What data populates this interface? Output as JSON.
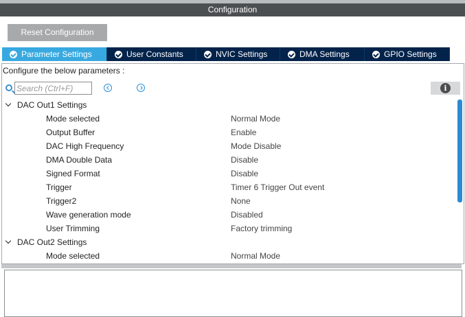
{
  "window": {
    "title": "Configuration"
  },
  "toolbar": {
    "reset_label": "Reset Configuration"
  },
  "tabs": [
    {
      "label": "Parameter Settings",
      "active": true,
      "icon": "check-circle-icon"
    },
    {
      "label": "User Constants",
      "active": false,
      "icon": "check-circle-icon"
    },
    {
      "label": "NVIC Settings",
      "active": false,
      "icon": "check-circle-icon"
    },
    {
      "label": "DMA Settings",
      "active": false,
      "icon": "check-circle-icon"
    },
    {
      "label": "GPIO Settings",
      "active": false,
      "icon": "check-circle-icon"
    }
  ],
  "panel": {
    "instruction": "Configure the below parameters :",
    "search": {
      "placeholder": "Search (Ctrl+F)",
      "value": ""
    },
    "icons": {
      "search": "search-icon",
      "prev": "previous-icon",
      "next": "next-icon",
      "info": "info-icon"
    }
  },
  "groups": [
    {
      "label": "DAC Out1 Settings",
      "expanded": true,
      "params": [
        {
          "name": "Mode selected",
          "value": "Normal Mode"
        },
        {
          "name": "Output Buffer",
          "value": "Enable"
        },
        {
          "name": "DAC High Frequency",
          "value": "Mode Disable"
        },
        {
          "name": "DMA Double Data",
          "value": "Disable"
        },
        {
          "name": "Signed Format",
          "value": "Disable"
        },
        {
          "name": "Trigger",
          "value": "Timer 6 Trigger Out event"
        },
        {
          "name": "Trigger2",
          "value": "None"
        },
        {
          "name": "Wave generation mode",
          "value": "Disabled"
        },
        {
          "name": "User Trimming",
          "value": "Factory trimming"
        }
      ]
    },
    {
      "label": "DAC Out2 Settings",
      "expanded": true,
      "params": [
        {
          "name": "Mode selected",
          "value": "Normal Mode"
        }
      ]
    }
  ],
  "colors": {
    "title_bar": "#4c4f52",
    "tab_active": "#38a9e0",
    "tab_inactive": "#03234b",
    "accent": "#2b8ad3",
    "button": "#a7a9ab"
  }
}
